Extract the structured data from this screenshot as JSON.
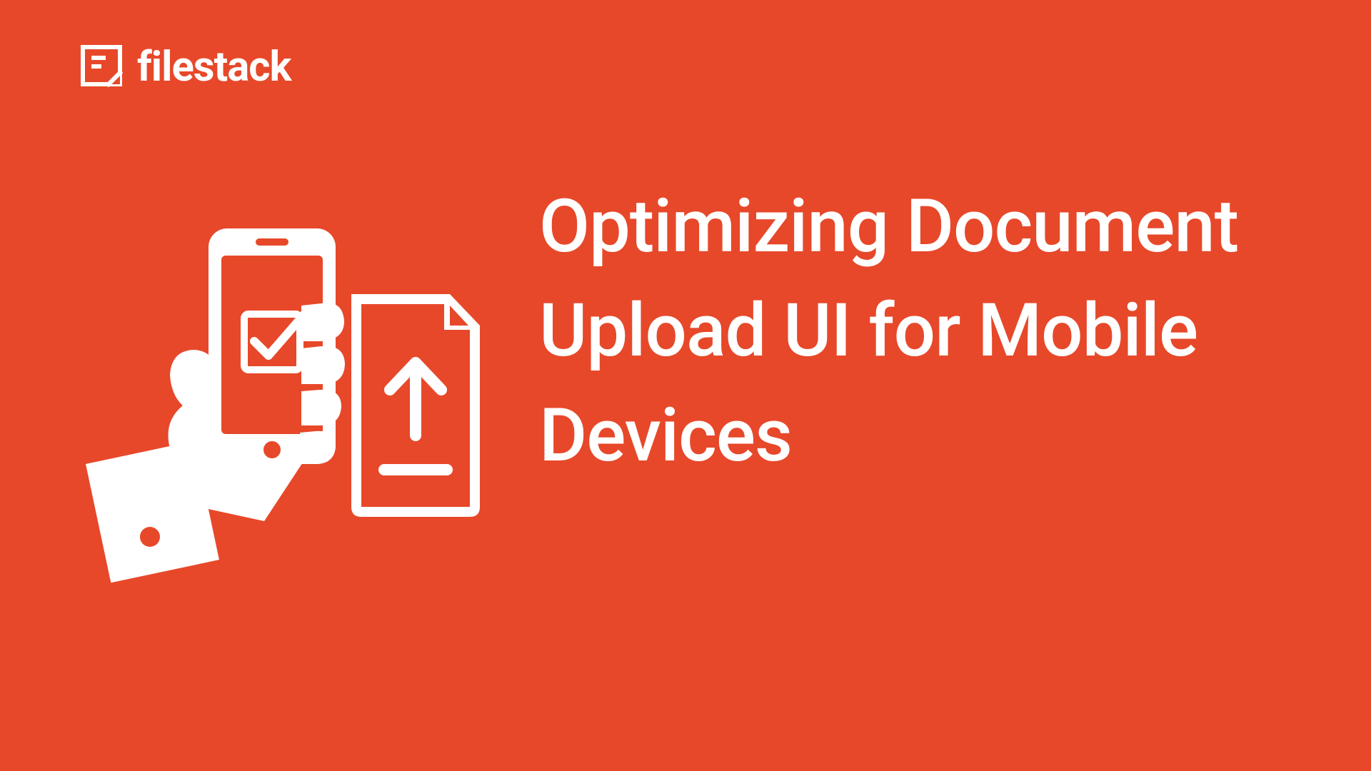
{
  "brand": {
    "name": "filestack"
  },
  "headline": {
    "text": "Optimizing Document Upload UI for Mobile Devices"
  },
  "colors": {
    "background": "#E7482A",
    "foreground": "#FFFFFF"
  },
  "icons": {
    "logo": "filestack-logo",
    "illustration": "hand-phone-upload-document"
  }
}
